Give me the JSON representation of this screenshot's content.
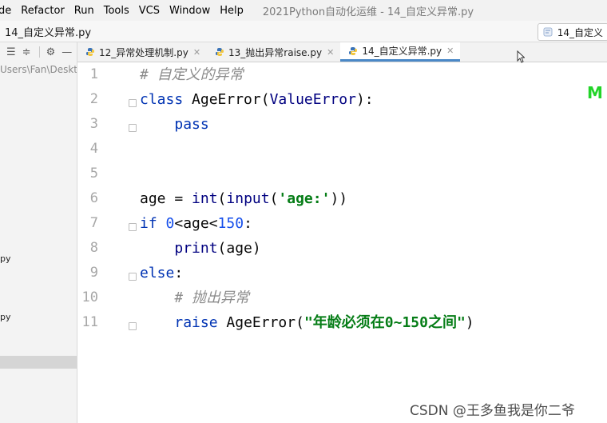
{
  "menubar": {
    "items": [
      "de",
      "Refactor",
      "Run",
      "Tools",
      "VCS",
      "Window",
      "Help"
    ],
    "window_title": "2021Python自动化运维 - 14_自定义异常.py"
  },
  "navbar": {
    "breadcrumb": "14_自定义异常.py",
    "run_config": "14_自定义"
  },
  "project": {
    "path": "Users\\Fan\\Desktop",
    "partial_items": [
      "py",
      "py"
    ]
  },
  "tabs": [
    {
      "label": "12_异常处理机制.py",
      "active": false
    },
    {
      "label": "13_抛出异常raise.py",
      "active": false
    },
    {
      "label": "14_自定义异常.py",
      "active": true
    }
  ],
  "editor": {
    "line_numbers": [
      "1",
      "2",
      "3",
      "4",
      "5",
      "6",
      "7",
      "8",
      "9",
      "10",
      "11"
    ],
    "lines": [
      {
        "indent": "",
        "tokens": [
          {
            "t": "# 自定义的异常",
            "c": "cm"
          }
        ]
      },
      {
        "indent": "",
        "tokens": [
          {
            "t": "class ",
            "c": "kw"
          },
          {
            "t": "AgeError(",
            "c": "df"
          },
          {
            "t": "ValueError",
            "c": "bi"
          },
          {
            "t": "):",
            "c": "df"
          }
        ]
      },
      {
        "indent": "    ",
        "tokens": [
          {
            "t": "pass",
            "c": "kw"
          }
        ]
      },
      {
        "indent": "",
        "tokens": []
      },
      {
        "indent": "",
        "tokens": []
      },
      {
        "indent": "",
        "tokens": [
          {
            "t": "age = ",
            "c": "df"
          },
          {
            "t": "int",
            "c": "bi"
          },
          {
            "t": "(",
            "c": "df"
          },
          {
            "t": "input",
            "c": "bi"
          },
          {
            "t": "(",
            "c": "df"
          },
          {
            "t": "'age:'",
            "c": "st"
          },
          {
            "t": "))",
            "c": "df"
          }
        ]
      },
      {
        "indent": "",
        "tokens": [
          {
            "t": "if ",
            "c": "kw"
          },
          {
            "t": "0",
            "c": "nm"
          },
          {
            "t": "<age<",
            "c": "df"
          },
          {
            "t": "150",
            "c": "nm"
          },
          {
            "t": ":",
            "c": "df"
          }
        ]
      },
      {
        "indent": "    ",
        "tokens": [
          {
            "t": "print",
            "c": "bi"
          },
          {
            "t": "(age)",
            "c": "df"
          }
        ]
      },
      {
        "indent": "",
        "tokens": [
          {
            "t": "else",
            "c": "kw"
          },
          {
            "t": ":",
            "c": "df"
          }
        ]
      },
      {
        "indent": "    ",
        "tokens": [
          {
            "t": "# 抛出异常",
            "c": "cm"
          }
        ]
      },
      {
        "indent": "    ",
        "tokens": [
          {
            "t": "raise ",
            "c": "kw"
          },
          {
            "t": "AgeError(",
            "c": "df"
          },
          {
            "t": "\"年龄必须在0~150之间\"",
            "c": "st"
          },
          {
            "t": ")",
            "c": "df"
          }
        ]
      }
    ]
  },
  "overlay": {
    "green_mark": "M",
    "watermark": "CSDN @王多鱼我是你二爷"
  },
  "colors": {
    "keyword": "#0033b3",
    "string": "#067d17",
    "number": "#1750eb",
    "comment": "#8c8c8c",
    "active_tab_underline": "#4a88c7"
  }
}
